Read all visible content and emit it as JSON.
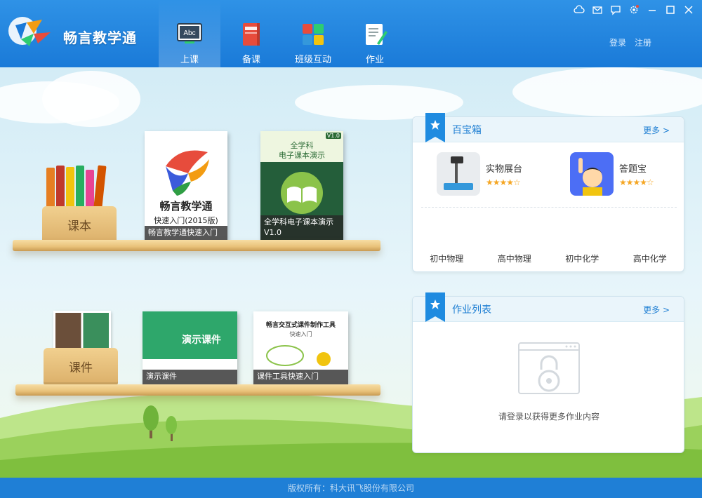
{
  "app": {
    "title": "畅言教学通"
  },
  "nav": [
    {
      "label": "上课",
      "icon": "abc-board-icon",
      "active": true
    },
    {
      "label": "备课",
      "icon": "notebook-icon",
      "active": false
    },
    {
      "label": "班级互动",
      "icon": "blocks-icon",
      "active": false
    },
    {
      "label": "作业",
      "icon": "homework-edit-icon",
      "active": false
    }
  ],
  "auth": {
    "login": "登录",
    "register": "注册"
  },
  "shelves": {
    "textbook": {
      "bin_label": "课本",
      "cards": [
        {
          "brand": "畅言教学通",
          "caption": "畅言教学通快速入门",
          "subtitle": "快速入门(2015版)"
        },
        {
          "heading_line1": "全学科",
          "heading_line2": "电子课本演示",
          "version": "V1.0",
          "caption": "全学科电子课本演示\nV1.0"
        }
      ]
    },
    "courseware": {
      "bin_label": "课件",
      "cards": [
        {
          "heading": "演示课件",
          "caption": "演示课件"
        },
        {
          "heading": "畅言交互式课件制作工具",
          "sub": "快速入门",
          "caption": "课件工具快速入门"
        }
      ]
    }
  },
  "toolbox": {
    "title": "百宝箱",
    "more": "更多 >",
    "tools": [
      {
        "name": "实物展台",
        "stars": "★★★★☆"
      },
      {
        "name": "答题宝",
        "stars": "★★★★☆"
      }
    ],
    "subjects": [
      "初中物理",
      "高中物理",
      "初中化学",
      "高中化学"
    ]
  },
  "homework": {
    "title": "作业列表",
    "more": "更多 >",
    "empty_text": "请登录以获得更多作业内容"
  },
  "footer": {
    "copyright": "版权所有：科大讯飞股份有限公司"
  },
  "colors": {
    "header": "#1a7ad8",
    "accent": "#1f7fd3",
    "star": "#f5a623",
    "footer": "#1f7fd6"
  }
}
